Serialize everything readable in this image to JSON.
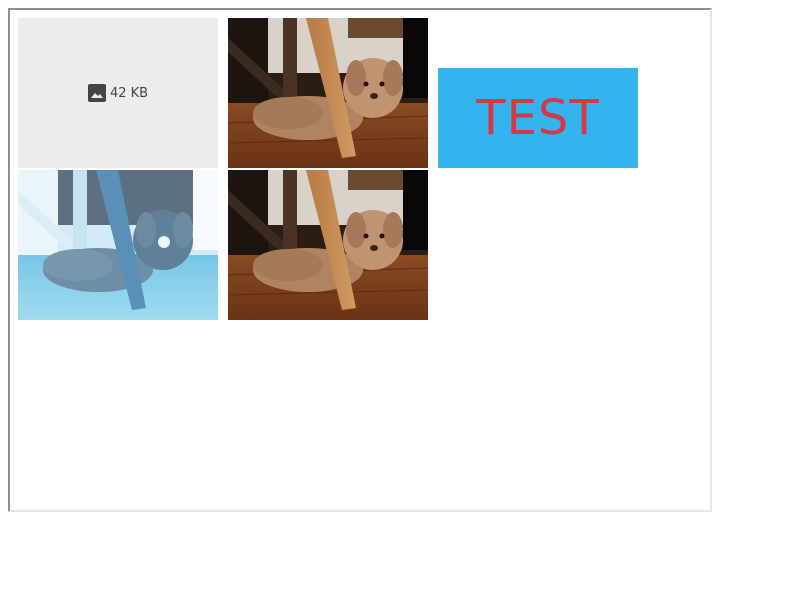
{
  "tiles": {
    "placeholder": {
      "icon": "image-icon",
      "size_label": "42 KB"
    },
    "photo_normal": {
      "icon": "puppy-photo"
    },
    "photo_inverted": {
      "icon": "puppy-photo-inverted"
    },
    "photo_normal_2": {
      "icon": "puppy-photo"
    }
  },
  "test_box": {
    "label": "TEST",
    "background": "#33b4ee",
    "text_color": "#d23a4a"
  }
}
